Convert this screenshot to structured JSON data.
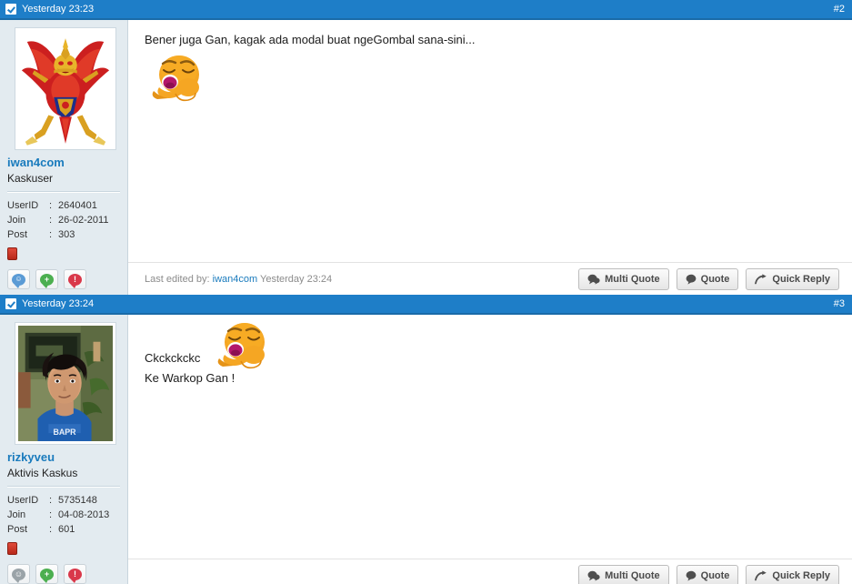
{
  "posts": [
    {
      "header": {
        "timestamp": "Yesterday 23:23",
        "number": "#2",
        "checkbox_icon": "checkbox-checked-icon"
      },
      "user": {
        "name": "iwan4com",
        "title": "Kaskuser",
        "avatar_icon": "garuda-emblem-avatar",
        "stats": [
          {
            "label": "UserID",
            "sep": ":",
            "value": "2640401"
          },
          {
            "label": "Join",
            "sep": ":",
            "value": "26-02-2011"
          },
          {
            "label": "Post",
            "sep": ":",
            "value": "303"
          }
        ],
        "buttons": [
          {
            "icon": "online-status-icon",
            "glyph": "☺",
            "style": "b-smiley"
          },
          {
            "icon": "add-reputation-icon",
            "glyph": "+",
            "style": "b-green"
          },
          {
            "icon": "report-post-icon",
            "glyph": "!",
            "style": "b-red"
          }
        ]
      },
      "message": {
        "lines": [
          "Bener juga Gan, kagak ada modal buat ngeGombal sana-sini..."
        ],
        "emoticon": "ngakak-emoticon"
      },
      "footer": {
        "last_edited_prefix": "Last edited by:",
        "last_edited_user": "iwan4com",
        "last_edited_time": "Yesterday 23:24",
        "buttons": [
          {
            "label": "Multi Quote",
            "icon": "multi-quote-icon"
          },
          {
            "label": "Quote",
            "icon": "quote-icon"
          },
          {
            "label": "Quick Reply",
            "icon": "quick-reply-icon"
          }
        ]
      }
    },
    {
      "header": {
        "timestamp": "Yesterday 23:24",
        "number": "#3",
        "checkbox_icon": "checkbox-checked-icon"
      },
      "user": {
        "name": "rizkyveu",
        "title": "Aktivis Kaskus",
        "avatar_icon": "user-photo-avatar",
        "stats": [
          {
            "label": "UserID",
            "sep": ":",
            "value": "5735148"
          },
          {
            "label": "Join",
            "sep": ":",
            "value": "04-08-2013"
          },
          {
            "label": "Post",
            "sep": ":",
            "value": "601"
          }
        ],
        "buttons": [
          {
            "icon": "offline-status-icon",
            "glyph": "☺",
            "style": "b-grey"
          },
          {
            "icon": "add-reputation-icon",
            "glyph": "+",
            "style": "b-green"
          },
          {
            "icon": "report-post-icon",
            "glyph": "!",
            "style": "b-red"
          }
        ]
      },
      "message": {
        "lines": [
          "Ckckckckc",
          "Ke Warkop Gan !"
        ],
        "emoticon": "ngakak-emoticon"
      },
      "footer": {
        "last_edited_prefix": "",
        "last_edited_user": "",
        "last_edited_time": "",
        "buttons": [
          {
            "label": "Multi Quote",
            "icon": "multi-quote-icon"
          },
          {
            "label": "Quote",
            "icon": "quote-icon"
          },
          {
            "label": "Quick Reply",
            "icon": "quick-reply-icon"
          }
        ]
      }
    }
  ],
  "colors": {
    "header_blue": "#1e7ec8",
    "sidebar_bg": "#e3ebf0",
    "link_blue": "#1a7bbd",
    "content_bg": "#ffffff"
  }
}
